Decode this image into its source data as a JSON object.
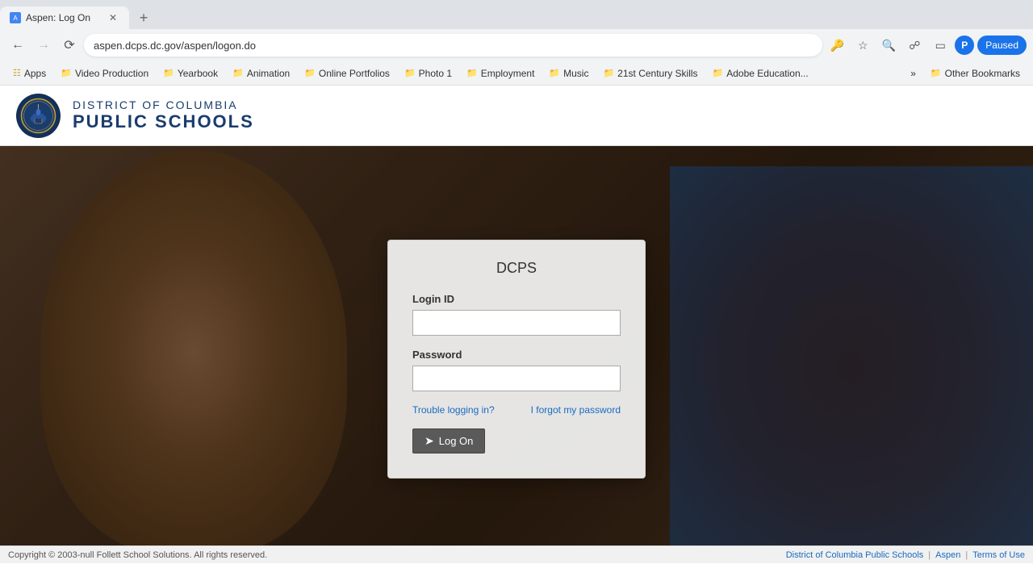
{
  "browser": {
    "tab": {
      "title": "Aspen: Log On",
      "favicon_label": "A"
    },
    "address": "aspen.dcps.dc.gov/aspen/logon.do",
    "nav": {
      "back_disabled": false,
      "forward_disabled": true,
      "reload_label": "⟳",
      "paused_label": "Paused"
    },
    "bookmarks": [
      {
        "label": "Apps"
      },
      {
        "label": "Video Production"
      },
      {
        "label": "Yearbook"
      },
      {
        "label": "Animation"
      },
      {
        "label": "Online Portfolios"
      },
      {
        "label": "Photo 1"
      },
      {
        "label": "Employment"
      },
      {
        "label": "Music"
      },
      {
        "label": "21st Century Skills"
      },
      {
        "label": "Adobe Education..."
      }
    ],
    "other_bookmarks": "Other Bookmarks"
  },
  "header": {
    "logo_top": "DISTRICT OF COLUMBIA",
    "logo_bottom": "PUBLIC SCHOOLS"
  },
  "login": {
    "title": "DCPS",
    "login_id_label": "Login ID",
    "login_id_placeholder": "",
    "password_label": "Password",
    "password_placeholder": "",
    "trouble_link": "Trouble logging in?",
    "forgot_link": "I forgot my password",
    "logon_button": "Log On"
  },
  "footer": {
    "copyright": "Copyright © 2003-null Follett School Solutions. All rights reserved.",
    "links": [
      {
        "label": "District of Columbia Public Schools"
      },
      {
        "label": "Aspen"
      },
      {
        "label": "Terms of Use"
      }
    ]
  }
}
